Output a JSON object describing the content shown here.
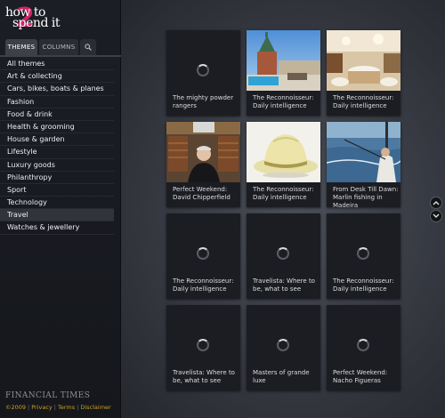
{
  "logo": {
    "line1": "how to",
    "line2": "spend it",
    "numeral": "2"
  },
  "tabs": {
    "themes": "THEMES",
    "columns": "COLUMNS"
  },
  "nav": [
    "All themes",
    "Art & collecting",
    "Cars, bikes, boats & planes",
    "Fashion",
    "Food & drink",
    "Health & grooming",
    "House & garden",
    "Lifestyle",
    "Luxury goods",
    "Philanthropy",
    "Sport",
    "Technology",
    "Travel",
    "Watches & jewellery"
  ],
  "nav_selected": "Travel",
  "footer": {
    "brand": "FINANCIAL TIMES",
    "copyright": "©2009",
    "privacy": "Privacy",
    "terms": "Terms",
    "disclaimer": "Disclaimer"
  },
  "tiles": [
    {
      "title": "The mighty powder rangers",
      "image": "loading-spinner"
    },
    {
      "title": "The Reconnoisseur: Daily intelligence",
      "image": "hotel-rooftop-pool"
    },
    {
      "title": "The Reconnoisseur: Daily intelligence",
      "image": "restaurant-interior"
    },
    {
      "title": "Perfect Weekend: David Chipperfield",
      "image": "man-in-library"
    },
    {
      "title": "The Reconnoisseur: Daily intelligence",
      "image": "pith-helmet"
    },
    {
      "title": "From Desk Till Dawn: Marlin fishing in Madeira",
      "image": "sea-fishing"
    },
    {
      "title": "The Reconnoisseur: Daily intelligence",
      "image": "loading-spinner"
    },
    {
      "title": "Travelista: Where to be, what to see",
      "image": "loading-spinner"
    },
    {
      "title": "The Reconnoisseur: Daily intelligence",
      "image": "loading-spinner"
    },
    {
      "title": "Travelista: Where to be, what to see",
      "image": "loading-spinner"
    },
    {
      "title": "Masters of grande luxe",
      "image": "loading-spinner"
    },
    {
      "title": "Perfect Weekend: Nacho Figueras",
      "image": "loading-spinner"
    }
  ],
  "scroll": {
    "up_icon": "chevron-up-icon",
    "down_icon": "chevron-down-icon"
  },
  "colors": {
    "accent_pink": "#e0246a",
    "link_gold": "#c9a227",
    "sidebar_bg": "#1b1e25"
  }
}
